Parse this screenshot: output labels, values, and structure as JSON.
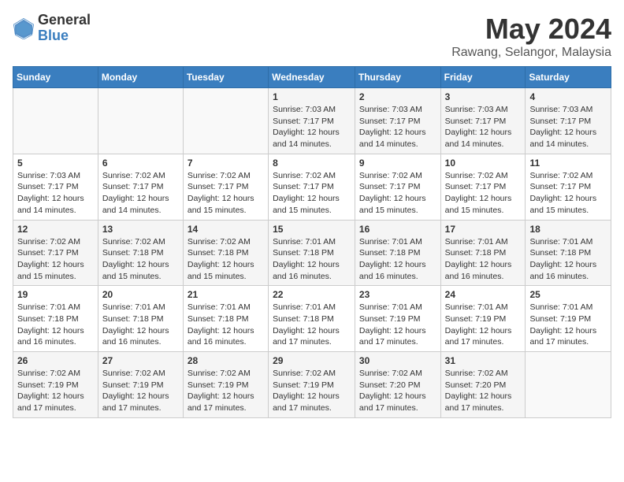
{
  "header": {
    "logo_general": "General",
    "logo_blue": "Blue",
    "month": "May 2024",
    "location": "Rawang, Selangor, Malaysia"
  },
  "days_of_week": [
    "Sunday",
    "Monday",
    "Tuesday",
    "Wednesday",
    "Thursday",
    "Friday",
    "Saturday"
  ],
  "weeks": [
    [
      {
        "day": "",
        "info": ""
      },
      {
        "day": "",
        "info": ""
      },
      {
        "day": "",
        "info": ""
      },
      {
        "day": "1",
        "info": "Sunrise: 7:03 AM\nSunset: 7:17 PM\nDaylight: 12 hours\nand 14 minutes."
      },
      {
        "day": "2",
        "info": "Sunrise: 7:03 AM\nSunset: 7:17 PM\nDaylight: 12 hours\nand 14 minutes."
      },
      {
        "day": "3",
        "info": "Sunrise: 7:03 AM\nSunset: 7:17 PM\nDaylight: 12 hours\nand 14 minutes."
      },
      {
        "day": "4",
        "info": "Sunrise: 7:03 AM\nSunset: 7:17 PM\nDaylight: 12 hours\nand 14 minutes."
      }
    ],
    [
      {
        "day": "5",
        "info": "Sunrise: 7:03 AM\nSunset: 7:17 PM\nDaylight: 12 hours\nand 14 minutes."
      },
      {
        "day": "6",
        "info": "Sunrise: 7:02 AM\nSunset: 7:17 PM\nDaylight: 12 hours\nand 14 minutes."
      },
      {
        "day": "7",
        "info": "Sunrise: 7:02 AM\nSunset: 7:17 PM\nDaylight: 12 hours\nand 15 minutes."
      },
      {
        "day": "8",
        "info": "Sunrise: 7:02 AM\nSunset: 7:17 PM\nDaylight: 12 hours\nand 15 minutes."
      },
      {
        "day": "9",
        "info": "Sunrise: 7:02 AM\nSunset: 7:17 PM\nDaylight: 12 hours\nand 15 minutes."
      },
      {
        "day": "10",
        "info": "Sunrise: 7:02 AM\nSunset: 7:17 PM\nDaylight: 12 hours\nand 15 minutes."
      },
      {
        "day": "11",
        "info": "Sunrise: 7:02 AM\nSunset: 7:17 PM\nDaylight: 12 hours\nand 15 minutes."
      }
    ],
    [
      {
        "day": "12",
        "info": "Sunrise: 7:02 AM\nSunset: 7:17 PM\nDaylight: 12 hours\nand 15 minutes."
      },
      {
        "day": "13",
        "info": "Sunrise: 7:02 AM\nSunset: 7:18 PM\nDaylight: 12 hours\nand 15 minutes."
      },
      {
        "day": "14",
        "info": "Sunrise: 7:02 AM\nSunset: 7:18 PM\nDaylight: 12 hours\nand 15 minutes."
      },
      {
        "day": "15",
        "info": "Sunrise: 7:01 AM\nSunset: 7:18 PM\nDaylight: 12 hours\nand 16 minutes."
      },
      {
        "day": "16",
        "info": "Sunrise: 7:01 AM\nSunset: 7:18 PM\nDaylight: 12 hours\nand 16 minutes."
      },
      {
        "day": "17",
        "info": "Sunrise: 7:01 AM\nSunset: 7:18 PM\nDaylight: 12 hours\nand 16 minutes."
      },
      {
        "day": "18",
        "info": "Sunrise: 7:01 AM\nSunset: 7:18 PM\nDaylight: 12 hours\nand 16 minutes."
      }
    ],
    [
      {
        "day": "19",
        "info": "Sunrise: 7:01 AM\nSunset: 7:18 PM\nDaylight: 12 hours\nand 16 minutes."
      },
      {
        "day": "20",
        "info": "Sunrise: 7:01 AM\nSunset: 7:18 PM\nDaylight: 12 hours\nand 16 minutes."
      },
      {
        "day": "21",
        "info": "Sunrise: 7:01 AM\nSunset: 7:18 PM\nDaylight: 12 hours\nand 16 minutes."
      },
      {
        "day": "22",
        "info": "Sunrise: 7:01 AM\nSunset: 7:18 PM\nDaylight: 12 hours\nand 17 minutes."
      },
      {
        "day": "23",
        "info": "Sunrise: 7:01 AM\nSunset: 7:19 PM\nDaylight: 12 hours\nand 17 minutes."
      },
      {
        "day": "24",
        "info": "Sunrise: 7:01 AM\nSunset: 7:19 PM\nDaylight: 12 hours\nand 17 minutes."
      },
      {
        "day": "25",
        "info": "Sunrise: 7:01 AM\nSunset: 7:19 PM\nDaylight: 12 hours\nand 17 minutes."
      }
    ],
    [
      {
        "day": "26",
        "info": "Sunrise: 7:02 AM\nSunset: 7:19 PM\nDaylight: 12 hours\nand 17 minutes."
      },
      {
        "day": "27",
        "info": "Sunrise: 7:02 AM\nSunset: 7:19 PM\nDaylight: 12 hours\nand 17 minutes."
      },
      {
        "day": "28",
        "info": "Sunrise: 7:02 AM\nSunset: 7:19 PM\nDaylight: 12 hours\nand 17 minutes."
      },
      {
        "day": "29",
        "info": "Sunrise: 7:02 AM\nSunset: 7:19 PM\nDaylight: 12 hours\nand 17 minutes."
      },
      {
        "day": "30",
        "info": "Sunrise: 7:02 AM\nSunset: 7:20 PM\nDaylight: 12 hours\nand 17 minutes."
      },
      {
        "day": "31",
        "info": "Sunrise: 7:02 AM\nSunset: 7:20 PM\nDaylight: 12 hours\nand 17 minutes."
      },
      {
        "day": "",
        "info": ""
      }
    ]
  ]
}
